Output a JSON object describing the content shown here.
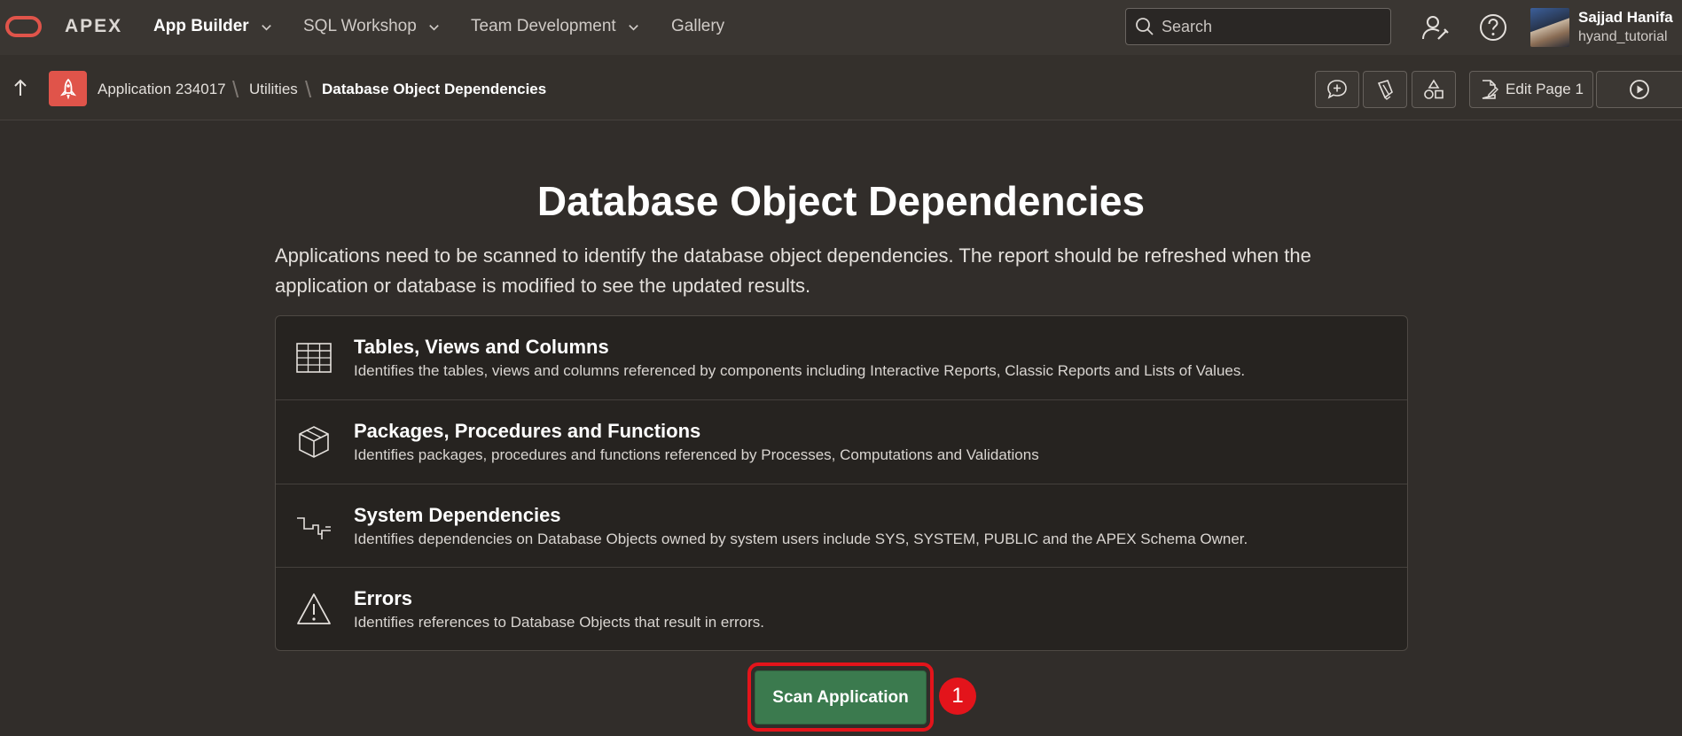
{
  "topnav": {
    "brand": "APEX",
    "items": [
      {
        "label": "App Builder"
      },
      {
        "label": "SQL Workshop"
      },
      {
        "label": "Team Development"
      },
      {
        "label": "Gallery"
      }
    ],
    "search_placeholder": "Search",
    "user": {
      "name": "Sajjad Hanifa",
      "workspace": "hyand_tutorial"
    },
    "icons": [
      "oracle-logo-icon",
      "chevron-down-icon",
      "search-icon",
      "administration-icon",
      "help-icon",
      "avatar"
    ]
  },
  "breadcrumb": {
    "items": [
      "Application 234017",
      "Utilities",
      "Database Object Dependencies"
    ],
    "icons": [
      "up-arrow-icon",
      "app-rocket-icon"
    ]
  },
  "toolbar": {
    "edit_page_label": "Edit Page 1",
    "icons": [
      "comment-add-icon",
      "highlighter-icon",
      "shapes-icon",
      "edit-page-icon",
      "run-page-icon"
    ]
  },
  "main": {
    "title": "Database Object Dependencies",
    "description": "Applications need to be scanned to identify the database object dependencies. The report should be refreshed when the application or database is modified to see the updated results.",
    "categories": [
      {
        "title": "Tables, Views and Columns",
        "description": "Identifies the tables, views and columns referenced by components including Interactive Reports, Classic Reports and Lists of Values.",
        "icon": "table-icon"
      },
      {
        "title": "Packages, Procedures and Functions",
        "description": "Identifies packages, procedures and functions referenced by Processes, Computations and Validations",
        "icon": "package-icon"
      },
      {
        "title": "System Dependencies",
        "description": "Identifies dependencies on Database Objects owned by system users include SYS, SYSTEM, PUBLIC and the APEX Schema Owner.",
        "icon": "dependency-icon"
      },
      {
        "title": "Errors",
        "description": "Identifies references to Database Objects that result in errors.",
        "icon": "warning-icon"
      }
    ],
    "scan_button_label": "Scan Application",
    "annotation_step": "1"
  },
  "colors": {
    "background": "#312d2a",
    "accent_red": "#e0544a",
    "scan_button": "#3b7a4e",
    "annotation_red": "#e3141b"
  }
}
